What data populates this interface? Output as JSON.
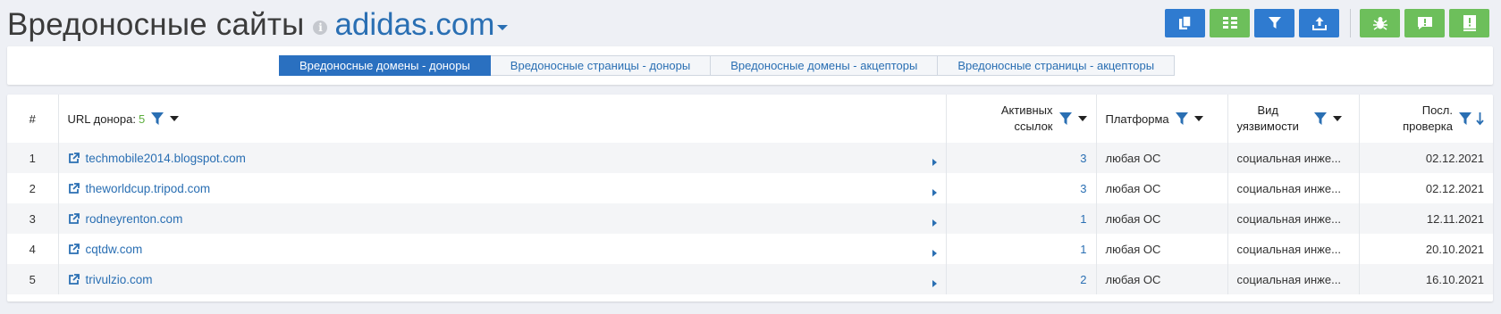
{
  "header": {
    "title": "Вредоносные сайты",
    "info_icon": "info-icon",
    "domain": "adidas.com"
  },
  "toolbar": {
    "buttons": [
      {
        "icon": "copy-icon",
        "color": "#2f7bd0"
      },
      {
        "icon": "columns-icon",
        "color": "#6dbf5b"
      },
      {
        "icon": "filter-icon",
        "color": "#2f7bd0"
      },
      {
        "icon": "export-icon",
        "color": "#2f7bd0"
      },
      {
        "icon": "bug-icon",
        "color": "#6dbf5b"
      },
      {
        "icon": "feedback-icon",
        "color": "#6dbf5b"
      },
      {
        "icon": "help-book-icon",
        "color": "#6dbf5b"
      }
    ]
  },
  "tabs": [
    {
      "label": "Вредоносные домены - доноры",
      "active": true
    },
    {
      "label": "Вредоносные страницы - доноры",
      "active": false
    },
    {
      "label": "Вредоносные домены - акцепторы",
      "active": false
    },
    {
      "label": "Вредоносные страницы - акцепторы",
      "active": false
    }
  ],
  "table": {
    "columns": {
      "num": "#",
      "url": "URL донора:",
      "url_count": "5",
      "active_links_1": "Активных",
      "active_links_2": "ссылок",
      "platform": "Платформа",
      "vuln_1": "Вид",
      "vuln_2": "уязвимости",
      "last_check_1": "Посл.",
      "last_check_2": "проверка"
    },
    "rows": [
      {
        "num": "1",
        "url": "techmobile2014.blogspot.com",
        "active": "3",
        "platform": "любая ОС",
        "vuln": "социальная инже...",
        "date": "02.12.2021"
      },
      {
        "num": "2",
        "url": "theworldcup.tripod.com",
        "active": "3",
        "platform": "любая ОС",
        "vuln": "социальная инже...",
        "date": "02.12.2021"
      },
      {
        "num": "3",
        "url": "rodneyrenton.com",
        "active": "1",
        "platform": "любая ОС",
        "vuln": "социальная инже...",
        "date": "12.11.2021"
      },
      {
        "num": "4",
        "url": "cqtdw.com",
        "active": "1",
        "platform": "любая ОС",
        "vuln": "социальная инже...",
        "date": "20.10.2021"
      },
      {
        "num": "5",
        "url": "trivulzio.com",
        "active": "2",
        "platform": "любая ОС",
        "vuln": "социальная инже...",
        "date": "16.10.2021"
      }
    ]
  },
  "colors": {
    "accent_blue": "#2a6fb3",
    "button_blue": "#2f7bd0",
    "button_green": "#6dbf5b",
    "count_green": "#5cae3d"
  }
}
